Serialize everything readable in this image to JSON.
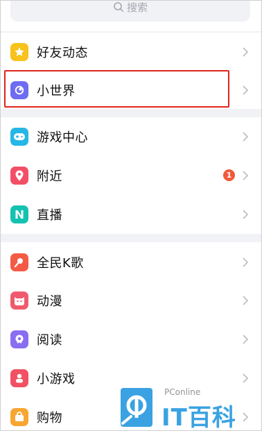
{
  "search": {
    "placeholder": "搜索",
    "icon": "search-icon"
  },
  "menu": {
    "group1": [
      {
        "label": "好友动态",
        "icon": "star-icon",
        "color": "#f7c21b"
      },
      {
        "label": "小世界",
        "icon": "planet-icon",
        "color": "#6d6cf2"
      }
    ],
    "group2": [
      {
        "label": "游戏中心",
        "icon": "gamepad-icon",
        "color": "#27b7e6"
      },
      {
        "label": "附近",
        "icon": "location-pin-icon",
        "color": "#f24f66",
        "badge": "1"
      },
      {
        "label": "直播",
        "icon": "live-icon",
        "color": "#14c2b0"
      }
    ],
    "group3": [
      {
        "label": "全民K歌",
        "icon": "karaoke-icon",
        "color": "#f45b46"
      },
      {
        "label": "动漫",
        "icon": "anime-icon",
        "color": "#f0596c"
      },
      {
        "label": "阅读",
        "icon": "book-icon",
        "color": "#8a6ef2"
      },
      {
        "label": "小游戏",
        "icon": "mini-game-icon",
        "color": "#f15163"
      },
      {
        "label": "购物",
        "icon": "shopping-icon",
        "color": "#f8a531"
      }
    ]
  },
  "watermark": {
    "small": "PConline",
    "brand": "IT百科"
  },
  "colors": {
    "highlight": "#e0241d",
    "separator": "#f1f2f5",
    "chevron": "#b9bcc2"
  }
}
